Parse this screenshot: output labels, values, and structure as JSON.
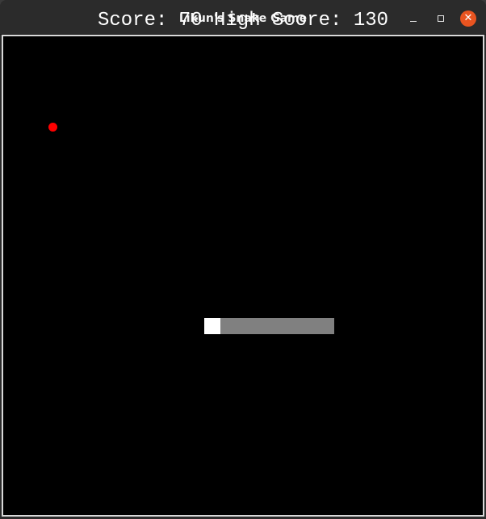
{
  "window": {
    "title": "Likun's Snake Game",
    "minimize_glyph": "",
    "maximize_glyph": "",
    "close_glyph": "✕"
  },
  "game": {
    "score_label": "Score:",
    "score": 70,
    "high_score_label": "High Score:",
    "high_score": 130,
    "score_text": "Score: 70 High Score: 130",
    "background_color": "#000000",
    "food_color": "#ff0000",
    "snake_head_color": "#ffffff",
    "snake_body_color": "#808080",
    "snake_length": 8,
    "snake_direction": "left"
  }
}
